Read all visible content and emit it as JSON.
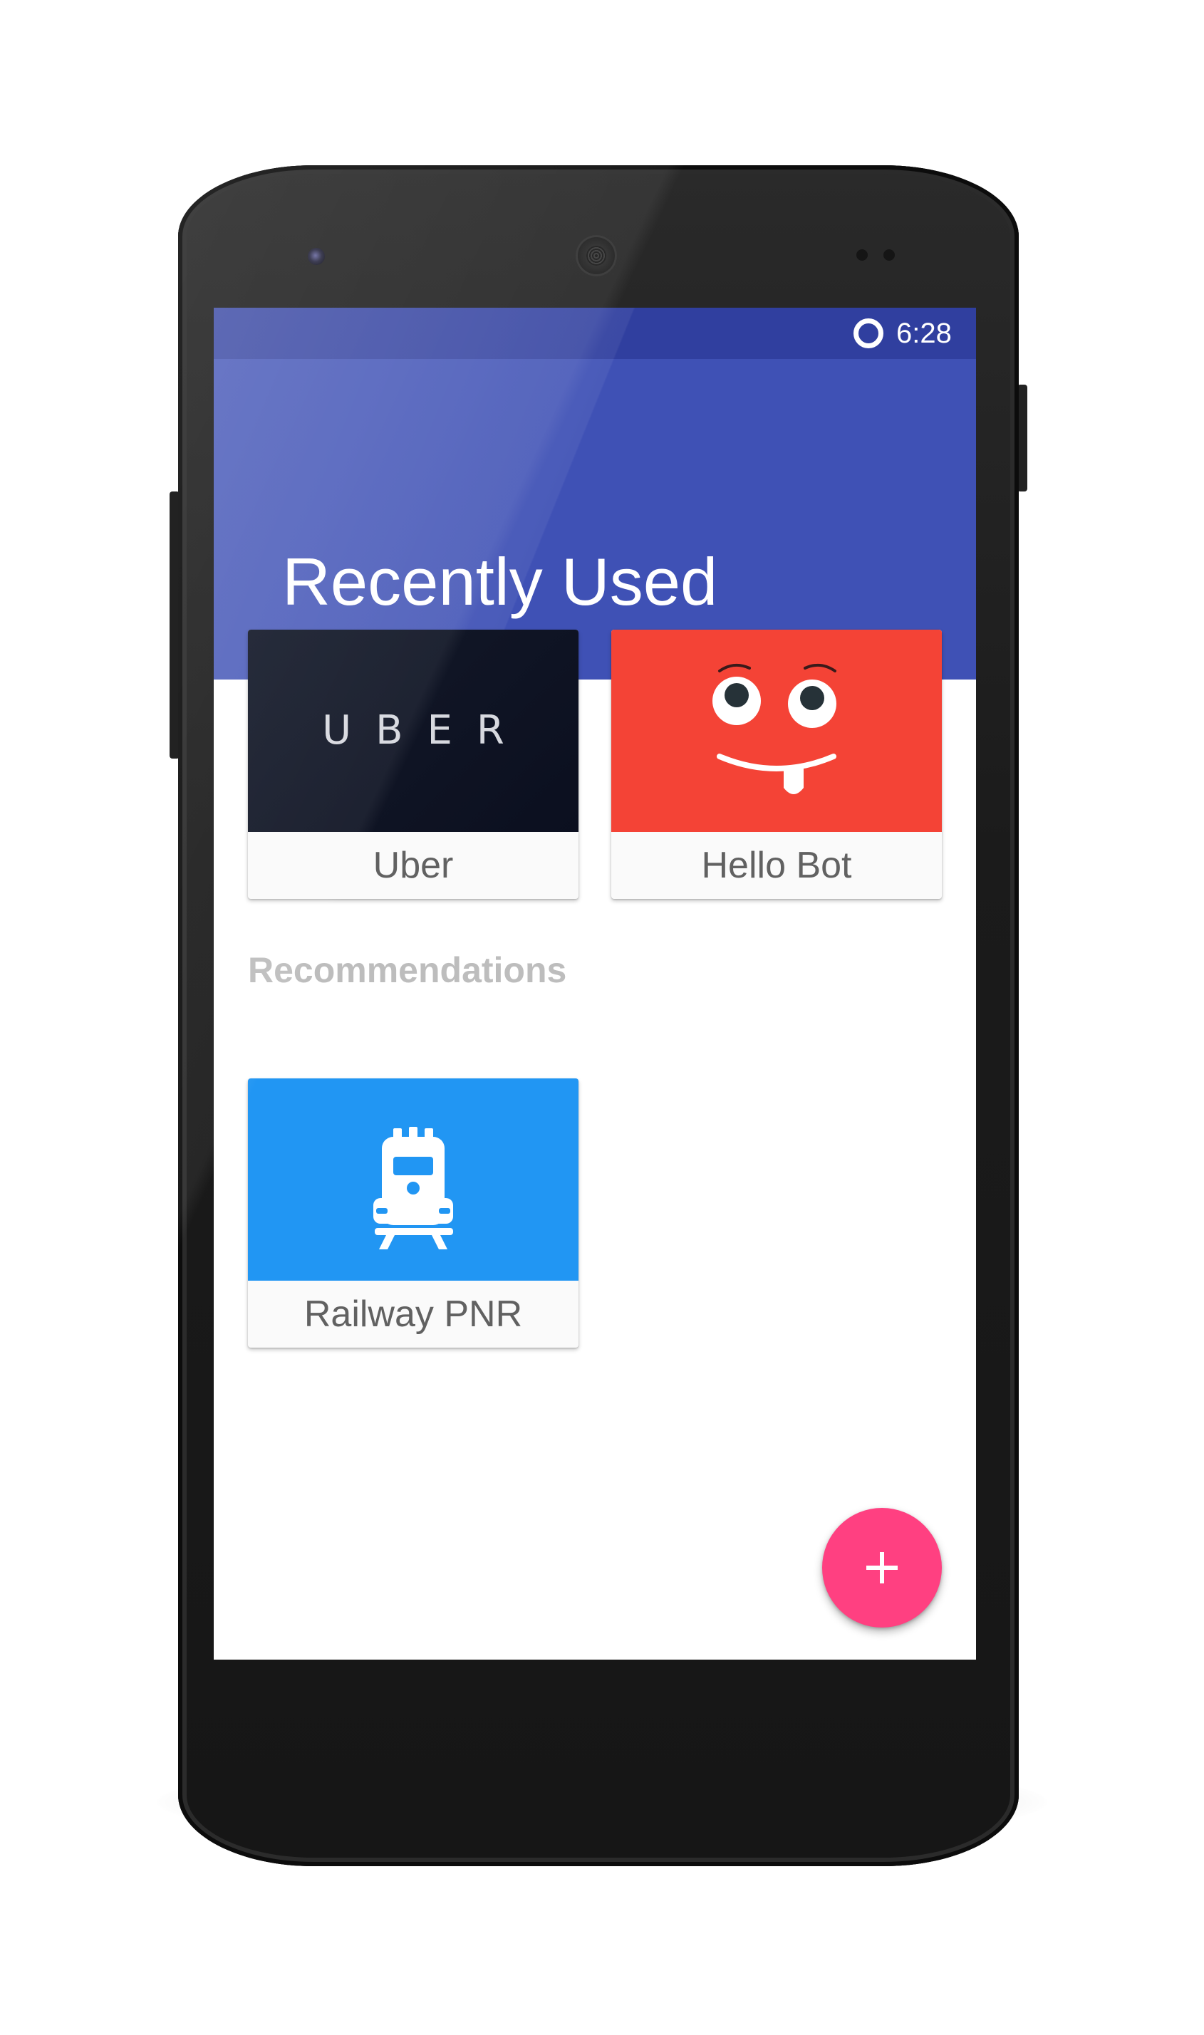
{
  "status_bar": {
    "time": "6:28"
  },
  "app_bar": {
    "title": "Recently Used"
  },
  "recently_used": [
    {
      "label": "Uber",
      "logo_text": "UBER",
      "color": "#0b0f1f"
    },
    {
      "label": "Hello Bot",
      "color": "#f44336"
    }
  ],
  "recommendations": {
    "title": "Recommendations",
    "items": [
      {
        "label": "Railway PNR",
        "color": "#2196f3",
        "icon": "train-icon"
      }
    ]
  },
  "fab": {
    "icon": "plus-icon",
    "color": "#ff4081"
  },
  "colors": {
    "primary": "#3f51b5",
    "primary_dark": "#303f9f",
    "accent": "#ff4081"
  }
}
